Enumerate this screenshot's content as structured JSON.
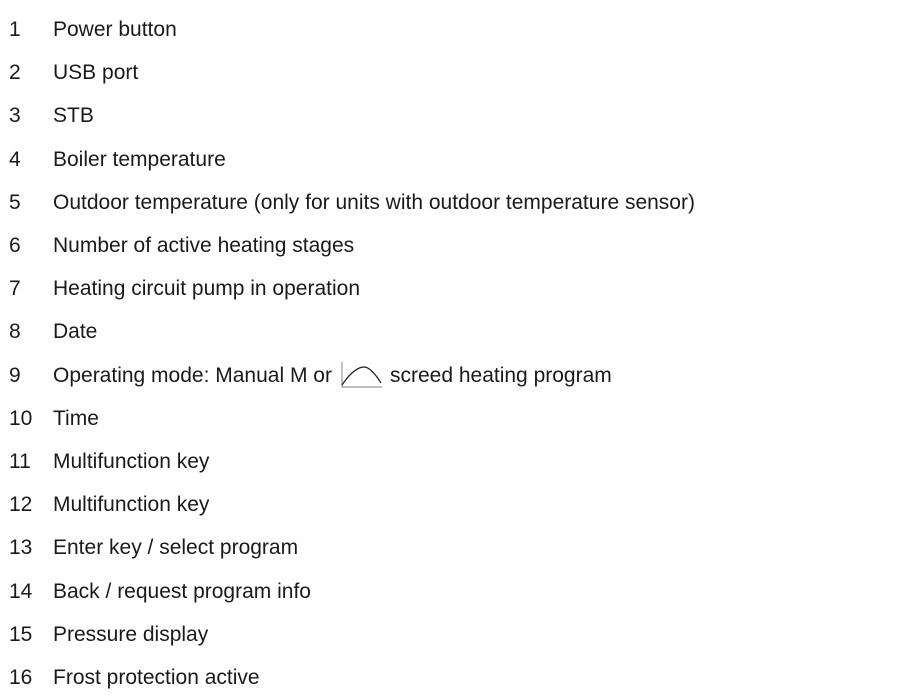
{
  "items": [
    {
      "number": "1",
      "text": "Power button"
    },
    {
      "number": "2",
      "text": "USB port"
    },
    {
      "number": "3",
      "text": "STB"
    },
    {
      "number": "4",
      "text": "Boiler temperature"
    },
    {
      "number": "5",
      "text": "Outdoor temperature (only for units with outdoor temperature sensor)"
    },
    {
      "number": "6",
      "text": "Number of active heating stages"
    },
    {
      "number": "7",
      "text": "Heating circuit pump in operation"
    },
    {
      "number": "8",
      "text": "Date"
    },
    {
      "number": "9",
      "text_before": "Operating mode: Manual M or",
      "text_after": "screed heating program",
      "icon": "screed-heating-curve-icon"
    },
    {
      "number": "10",
      "text": "Time"
    },
    {
      "number": "11",
      "text": "Multifunction key"
    },
    {
      "number": "12",
      "text": "Multifunction key"
    },
    {
      "number": "13",
      "text": "Enter key / select program"
    },
    {
      "number": "14",
      "text": "Back / request program info"
    },
    {
      "number": "15",
      "text": "Pressure display"
    },
    {
      "number": "16",
      "text": "Frost protection active"
    }
  ]
}
